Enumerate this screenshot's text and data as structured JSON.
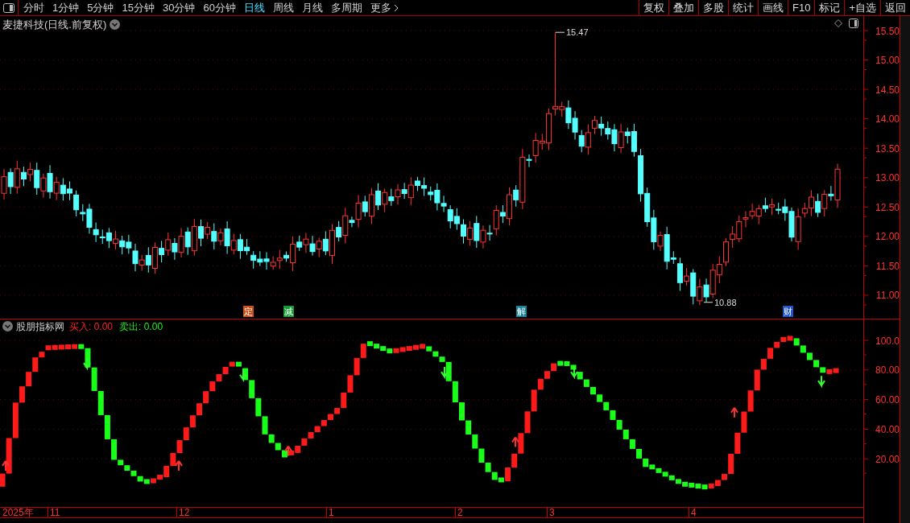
{
  "toolbar": {
    "periods": [
      {
        "label": "分时",
        "selected": false
      },
      {
        "label": "1分钟",
        "selected": false
      },
      {
        "label": "5分钟",
        "selected": false
      },
      {
        "label": "15分钟",
        "selected": false
      },
      {
        "label": "30分钟",
        "selected": false
      },
      {
        "label": "60分钟",
        "selected": false
      },
      {
        "label": "日线",
        "selected": true
      },
      {
        "label": "周线",
        "selected": false
      },
      {
        "label": "月线",
        "selected": false
      },
      {
        "label": "多周期",
        "selected": false
      },
      {
        "label": "更多",
        "selected": false
      }
    ],
    "actions": [
      "复权",
      "叠加",
      "多股",
      "统计",
      "画线",
      "F10",
      "标记",
      "+自选",
      "返回"
    ]
  },
  "chart": {
    "title": "麦捷科技(日线.前复权)",
    "high_label": "15.47",
    "low_label": "10.88",
    "y_axis": [
      "15.50",
      "15.00",
      "14.50",
      "14.00",
      "13.50",
      "13.00",
      "12.50",
      "12.00",
      "11.50",
      "11.00"
    ],
    "events": [
      {
        "label": "定",
        "color": "#c8501a"
      },
      {
        "label": "减",
        "color": "#169a34"
      },
      {
        "label": "解",
        "color": "#1a7f9a"
      },
      {
        "label": "财",
        "color": "#1f55c8"
      }
    ]
  },
  "indicator": {
    "name": "股朋指标网",
    "buy_label": "买入:",
    "buy_value": "0.00",
    "sell_label": "卖出:",
    "sell_value": "0.00",
    "y_axis": [
      "100.0",
      "80.00",
      "60.00",
      "40.00",
      "20.00"
    ]
  },
  "time_axis": [
    "2025年",
    "11",
    "12",
    "1",
    "2",
    "3",
    "4"
  ]
}
